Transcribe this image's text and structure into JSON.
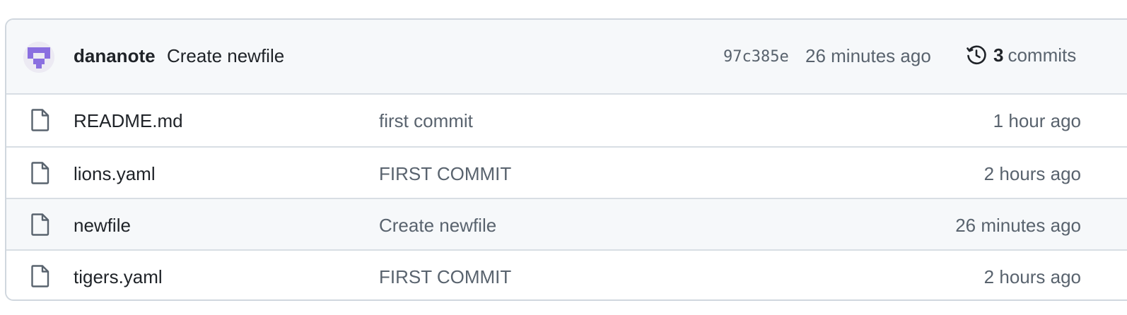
{
  "latest_commit": {
    "author": "dananote",
    "message": "Create newfile",
    "sha": "97c385e",
    "time": "26 minutes ago",
    "history": {
      "icon": "history-clock-icon",
      "count": "3",
      "label": "commits"
    }
  },
  "files": [
    {
      "icon": "file-icon",
      "name": "README.md",
      "commit": "first commit",
      "age": "1 hour ago"
    },
    {
      "icon": "file-icon",
      "name": "lions.yaml",
      "commit": "FIRST COMMIT",
      "age": "2 hours ago"
    },
    {
      "icon": "file-icon",
      "name": "newfile",
      "commit": "Create newfile",
      "age": "26 minutes ago"
    },
    {
      "icon": "file-icon",
      "name": "tigers.yaml",
      "commit": "FIRST COMMIT",
      "age": "2 hours ago"
    }
  ],
  "colors": {
    "border": "#d0d7de",
    "header_bg": "#f6f8fa",
    "text": "#1f2328",
    "muted": "#59636e",
    "avatar_purple": "#8a6fe0"
  }
}
